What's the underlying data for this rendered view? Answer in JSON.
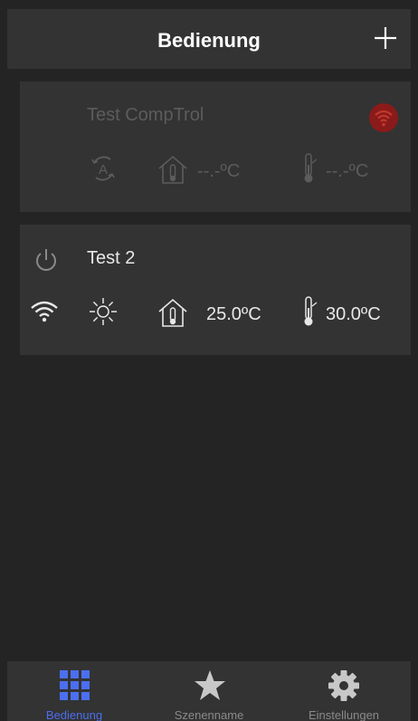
{
  "header": {
    "title": "Bedienung",
    "add_icon": "plus-icon"
  },
  "devices": [
    {
      "name": "Test CompTrol",
      "mode_icon": "auto-mode-icon",
      "indoor_temp": "--.-ºC",
      "outdoor_temp": "--.-ºC",
      "connection": "offline",
      "wifi_color": "#8b1a1a"
    },
    {
      "name": "Test 2",
      "mode_icon": "sun-icon",
      "indoor_temp": "25.0ºC",
      "outdoor_temp": "30.0ºC",
      "connection": "online",
      "power_icon": "power-icon"
    }
  ],
  "tabs": [
    {
      "label": "Bedienung",
      "icon": "grid-icon",
      "active": true
    },
    {
      "label": "Szenenname",
      "icon": "star-icon",
      "active": false
    },
    {
      "label": "Einstellungen",
      "icon": "gear-icon",
      "active": false
    }
  ],
  "colors": {
    "accent": "#4b6ff0",
    "background": "#242424",
    "card": "#333333"
  }
}
